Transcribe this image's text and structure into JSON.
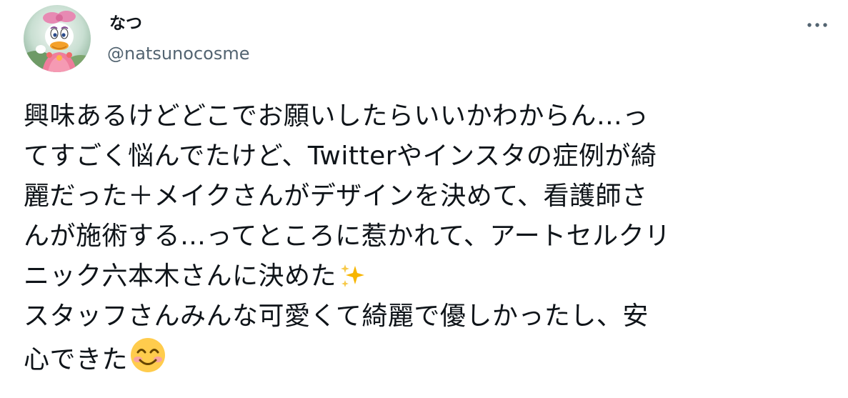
{
  "user": {
    "display_name": "なつ",
    "handle": "@natsunocosme",
    "avatar_icon": "daisy-duck-avatar"
  },
  "menu": {
    "more_icon": "more-horizontal-icon",
    "more_label": "•••"
  },
  "tweet": {
    "lines": [
      "興味あるけどどこでお願いしたらいいかわからん…っ",
      "てすごく悩んでたけど、Twitterやインスタの症例が綺",
      "麗だった＋メイクさんがデザインを決めて、看護師さ",
      "んが施術する…ってところに惹かれて、アートセルクリ",
      "ニック六本木さんに決めた",
      "スタッフさんみんな可愛くて綺麗で優しかったし、安",
      "心できた"
    ],
    "emoji_sparkles": "sparkles-emoji",
    "emoji_smile": "smiling-face-with-smiling-eyes-emoji"
  },
  "colors": {
    "text_primary": "#0f1419",
    "text_secondary": "#536471",
    "sparkle": "#f7b500",
    "smile_face": "#ffcc4d"
  }
}
